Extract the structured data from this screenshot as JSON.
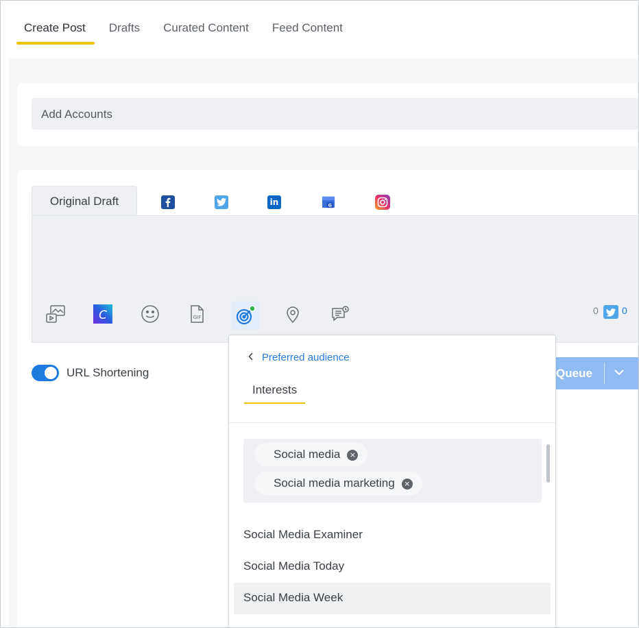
{
  "tabs": [
    {
      "label": "Create Post"
    },
    {
      "label": "Drafts"
    },
    {
      "label": "Curated Content"
    },
    {
      "label": "Feed Content"
    }
  ],
  "accounts": {
    "label": "Add Accounts"
  },
  "editor": {
    "original_tab": "Original Draft",
    "network_icons": [
      "facebook-icon",
      "twitter-icon",
      "linkedin-icon",
      "google-business-icon",
      "instagram-icon"
    ],
    "toolbar_icons": [
      "media-icon",
      "canva-icon",
      "emoji-icon",
      "gif-icon",
      "audience-target-icon",
      "location-icon",
      "first-comment-icon"
    ],
    "char_count_before": "0",
    "char_count_after": "0"
  },
  "url_shortening": {
    "label": "URL Shortening",
    "enabled": true
  },
  "queue_button": {
    "label": "Queue"
  },
  "audience_panel": {
    "back_label": "Preferred audience",
    "tab_label": "Interests",
    "selected_tags": [
      "Social media",
      "Social media marketing"
    ],
    "remove_glyph": "×",
    "suggestions": [
      "Social Media Examiner",
      "Social Media Today",
      "Social Media Week"
    ]
  },
  "colors": {
    "accent_yellow": "#f2c200",
    "primary_blue": "#1f7ae0",
    "link_blue": "#2a7ae2",
    "facebook": "#1f4f9f",
    "twitter": "#4ea5e8",
    "linkedin": "#0a66c2"
  }
}
